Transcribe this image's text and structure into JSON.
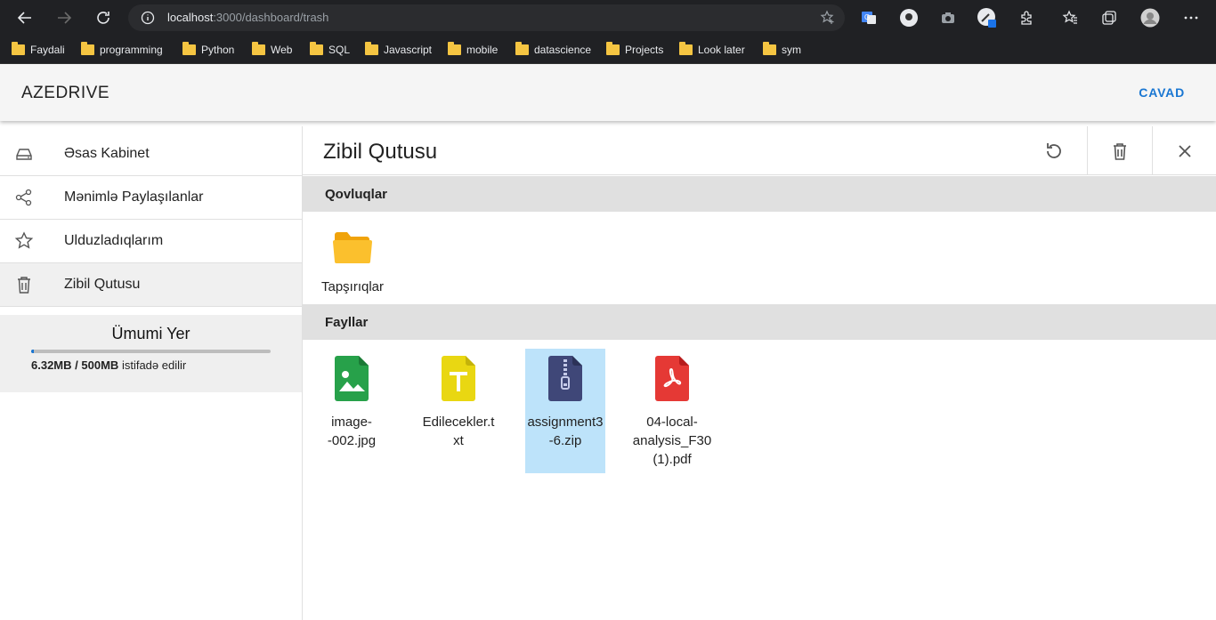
{
  "browser": {
    "url_host": "localhost",
    "url_path": ":3000/dashboard/trash",
    "bookmarks": [
      "Faydali",
      "programming",
      "Python",
      "Web",
      "SQL",
      "Javascript",
      "mobile",
      "datascience",
      "Projects",
      "Look later",
      "sym"
    ]
  },
  "app": {
    "logo": "AZEDRIVE",
    "logout": "CAVAD"
  },
  "sidebar": {
    "items": [
      {
        "label": "Əsas Kabinet",
        "icon": "drive-icon"
      },
      {
        "label": "Mənimlə Paylaşılanlar",
        "icon": "share-icon"
      },
      {
        "label": "Ulduzladıqlarım",
        "icon": "star-icon"
      },
      {
        "label": "Zibil Qutusu",
        "icon": "trash-icon",
        "active": true
      }
    ],
    "storage": {
      "title": "Ümumi Yer",
      "used": "6.32MB",
      "total": "500MB",
      "suffix": "istifadə edilir",
      "separator": "/",
      "fraction": 0.0126
    }
  },
  "main": {
    "title": "Zibil Qutusu",
    "tools": [
      "restore-icon",
      "delete-forever-icon",
      "close-icon"
    ],
    "folders_label": "Qovluqlar",
    "folders": [
      {
        "name": "Tapşırıqlar"
      }
    ],
    "files_label": "Fayllar",
    "files": [
      {
        "name": "image--002.jpg",
        "line1": "image-",
        "line2": "-002.jpg",
        "type": "image",
        "color": "#27a14a"
      },
      {
        "name": "Edilecekler.txt",
        "line1": "Edilecekler.t",
        "line2": "xt",
        "type": "text",
        "color": "#e9d712"
      },
      {
        "name": "assignment3-6.zip",
        "line1": "assignment3",
        "line2": "-6.zip",
        "type": "zip",
        "color": "#3f4778",
        "selected": true
      },
      {
        "name": "04-local-analysis_F30 (1).pdf",
        "line1": "04-local-",
        "line2": "analysis_F30",
        "line3": "(1).pdf",
        "type": "pdf",
        "color": "#e53935"
      }
    ]
  },
  "colors": {
    "accent": "#1976d2",
    "selected_bg": "#bde3fa",
    "folder": "#fbb726"
  }
}
